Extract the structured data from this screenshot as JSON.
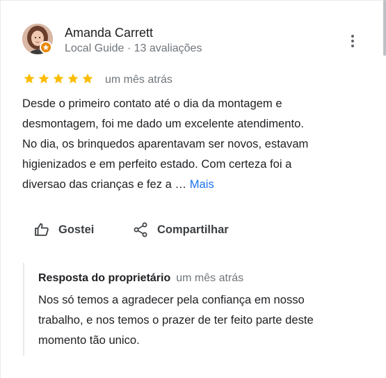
{
  "reviewer": {
    "name": "Amanda Carrett",
    "meta": "Local Guide · 13 avaliações"
  },
  "rating": {
    "stars": 5,
    "max": 5,
    "date": "um mês atrás"
  },
  "review": {
    "lines": [
      "Desde o primeiro contato até o dia da montagem e",
      "desmontagem, foi me dado um excelente atendimento.",
      "No dia, os brinquedos aparentavam ser novos, estavam",
      "higienizados e em perfeito estado. Com certeza foi a",
      "diversao das crianças e fez a … "
    ],
    "more_label": "Mais"
  },
  "actions": {
    "like_label": "Gostei",
    "share_label": "Compartilhar"
  },
  "owner_reply": {
    "title": "Resposta do proprietário",
    "date": "um mês atrás",
    "lines": [
      "Nos só temos a agradecer pela confiança em nosso",
      "trabalho, e nos temos o prazer de ter feito parte deste",
      "momento tão unico."
    ]
  },
  "icons": {
    "menu": "more-vert-icon",
    "star": "star-icon",
    "like": "thumb-up-icon",
    "share": "share-icon",
    "badge": "local-guide-badge-icon"
  },
  "colors": {
    "star": "#fbbc04",
    "link": "#1a73e8",
    "badge": "#ea8600"
  }
}
